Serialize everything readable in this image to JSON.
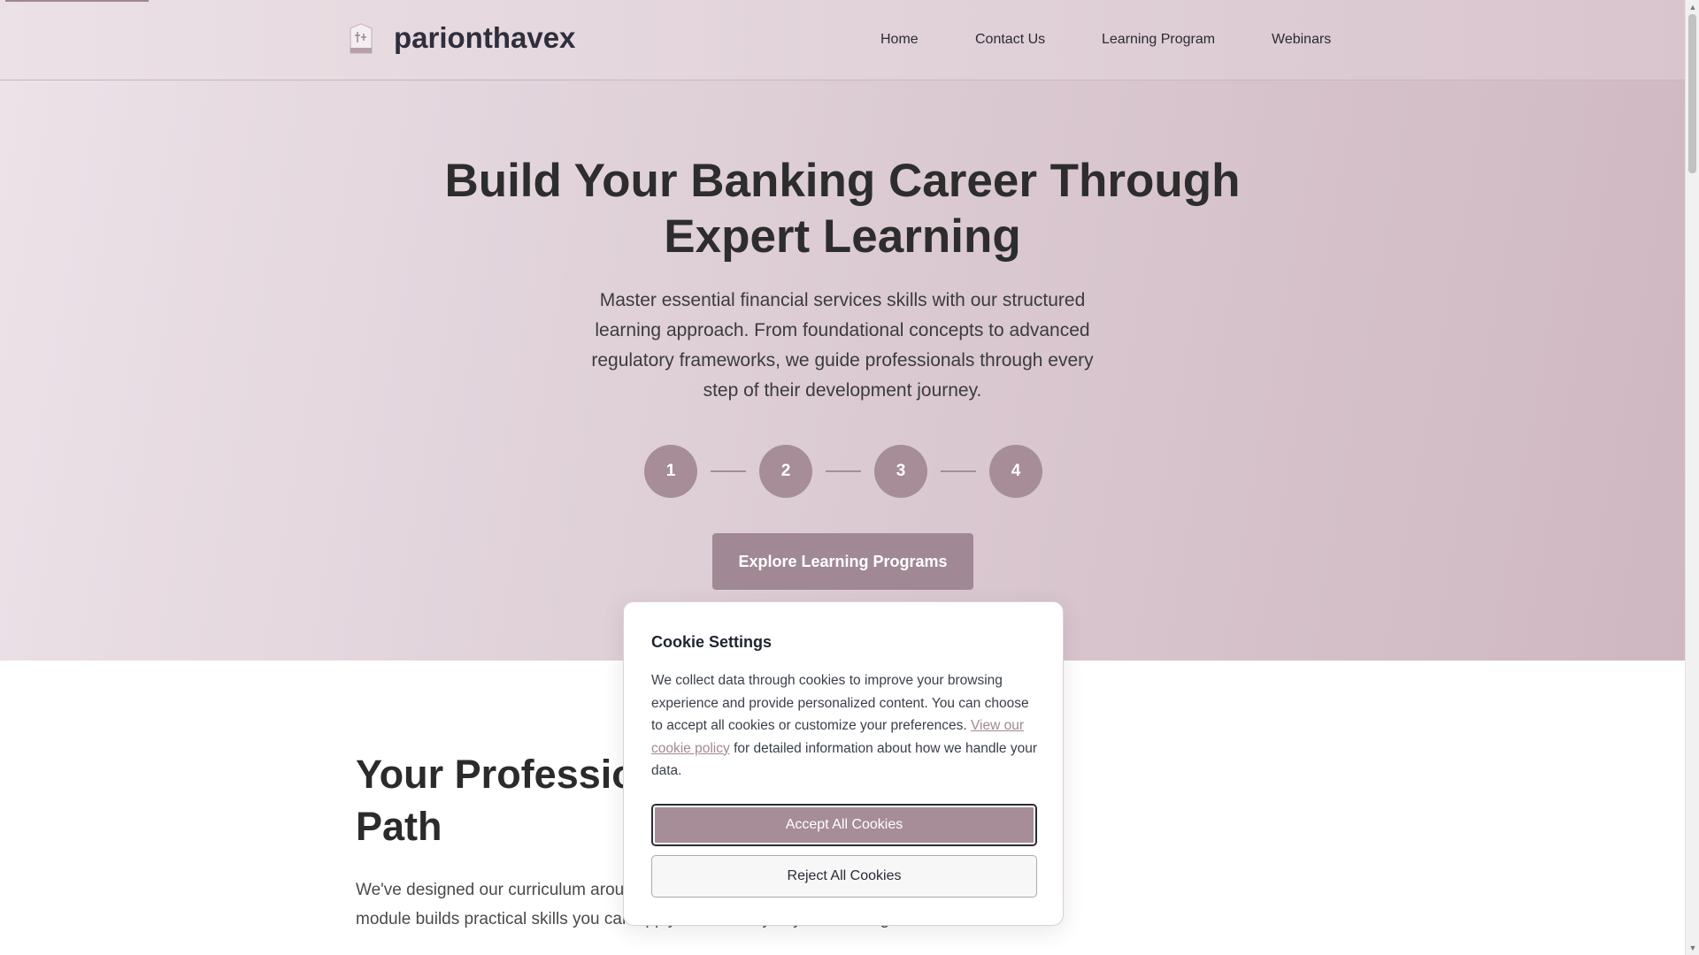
{
  "header": {
    "brand": "parionthavex",
    "nav": [
      {
        "label": "Home"
      },
      {
        "label": "Contact Us"
      },
      {
        "label": "Learning Program"
      },
      {
        "label": "Webinars"
      }
    ]
  },
  "hero": {
    "title": "Build Your Banking Career Through Expert Learning",
    "description": "Master essential financial services skills with our structured learning approach. From foundational concepts to advanced regulatory frameworks, we guide professionals through every step of their development journey.",
    "steps": [
      "1",
      "2",
      "3",
      "4"
    ],
    "cta_label": "Explore Learning Programs"
  },
  "section": {
    "title": "Your Professional Development Path",
    "text": "We've designed our curriculum around real-world banking challenges. Each module builds practical skills you can apply immediately in your banking career."
  },
  "cookie": {
    "title": "Cookie Settings",
    "text_before": "We collect data through cookies to improve your browsing experience and provide personalized content. You can choose to accept all cookies or customize your preferences.",
    "policy_link": "View our cookie policy",
    "text_after": "for detailed information about how we handle your data.",
    "accept_label": "Accept All Cookies",
    "reject_label": "Reject All Cookies"
  },
  "colors": {
    "accent": "#a68d98",
    "header_bg": "#ebe1e6",
    "text_dark": "#2d2d2d"
  }
}
